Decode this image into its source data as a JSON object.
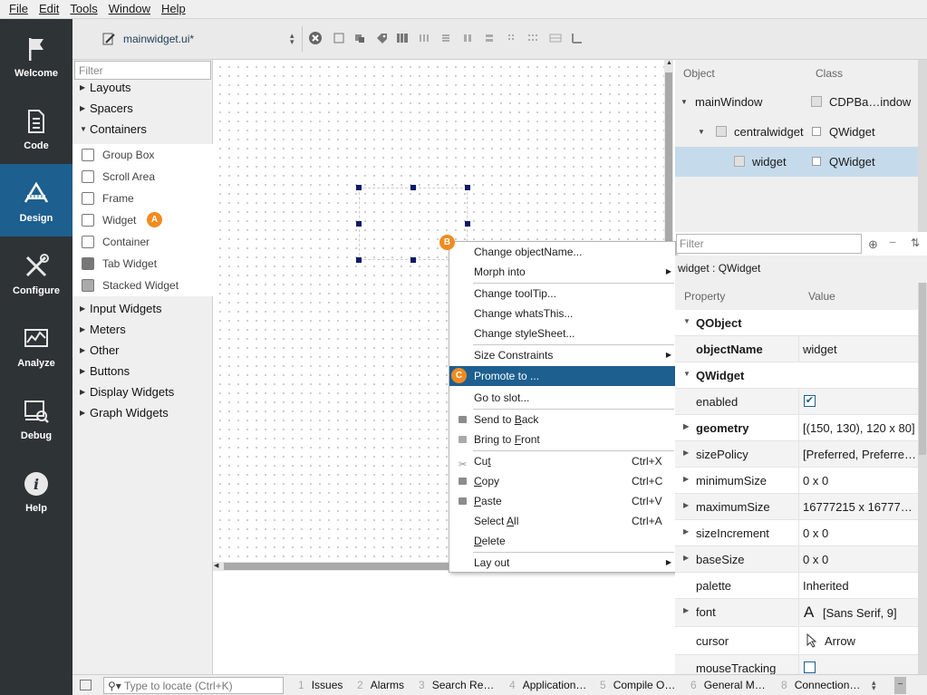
{
  "menubar": [
    "File",
    "Edit",
    "Tools",
    "Window",
    "Help"
  ],
  "modes": [
    {
      "label": "Welcome",
      "icon": "flag-icon"
    },
    {
      "label": "Code",
      "icon": "document-icon"
    },
    {
      "label": "Design",
      "icon": "design-icon"
    },
    {
      "label": "Configure",
      "icon": "tools-icon"
    },
    {
      "label": "Analyze",
      "icon": "chart-icon"
    },
    {
      "label": "Debug",
      "icon": "debug-icon"
    },
    {
      "label": "Help",
      "icon": "info-icon"
    }
  ],
  "toolbar": {
    "file_name": "mainwidget.ui*"
  },
  "widget_box": {
    "filter_placeholder": "Filter",
    "categories_top": [
      "Layouts",
      "Spacers",
      "Containers"
    ],
    "container_items": [
      "Group Box",
      "Scroll Area",
      "Frame",
      "Widget",
      "Container",
      "Tab Widget",
      "Stacked Widget"
    ],
    "categories_bottom": [
      "Input Widgets",
      "Meters",
      "Other",
      "Buttons",
      "Display Widgets",
      "Graph Widgets"
    ],
    "badge_a": "A"
  },
  "badges": {
    "b": "B",
    "c": "C"
  },
  "context_menu": {
    "change_object_name": "Change objectName...",
    "morph_into": "Morph into",
    "change_tooltip": "Change toolTip...",
    "change_whatsthis": "Change whatsThis...",
    "change_stylesheet": "Change styleSheet...",
    "size_constraints": "Size Constraints",
    "promote_to": "Promote to ...",
    "go_to_slot": "Go to slot...",
    "send_to_back_pre": "Send to ",
    "send_to_back_u": "B",
    "send_to_back_post": "ack",
    "bring_to_front_pre": "Bring to ",
    "bring_to_front_u": "F",
    "bring_to_front_post": "ront",
    "cut_pre": "Cu",
    "cut_u": "t",
    "cut_shortcut": "Ctrl+X",
    "copy_u": "C",
    "copy_post": "opy",
    "copy_shortcut": "Ctrl+C",
    "paste_u": "P",
    "paste_post": "aste",
    "paste_shortcut": "Ctrl+V",
    "select_all_pre": "Select ",
    "select_all_u": "A",
    "select_all_post": "ll",
    "select_all_shortcut": "Ctrl+A",
    "delete_u": "D",
    "delete_post": "elete",
    "lay_out": "Lay out"
  },
  "object_inspector": {
    "header_object": "Object",
    "header_class": "Class",
    "rows": [
      {
        "object": "mainWindow",
        "class": "CDPBa…indow"
      },
      {
        "object": "centralwidget",
        "class": "QWidget"
      },
      {
        "object": "widget",
        "class": "QWidget"
      }
    ]
  },
  "property_editor": {
    "filter_placeholder": "Filter",
    "class_label": "widget : QWidget",
    "header_property": "Property",
    "header_value": "Value",
    "rows": [
      {
        "name": "QObject",
        "value": ""
      },
      {
        "name": "objectName",
        "value": "widget"
      },
      {
        "name": "QWidget",
        "value": ""
      },
      {
        "name": "enabled",
        "value": "",
        "checked": true
      },
      {
        "name": "geometry",
        "value": "[(150, 130), 120 x 80]"
      },
      {
        "name": "sizePolicy",
        "value": "[Preferred, Preferre…"
      },
      {
        "name": "minimumSize",
        "value": "0 x 0"
      },
      {
        "name": "maximumSize",
        "value": "16777215 x 16777…"
      },
      {
        "name": "sizeIncrement",
        "value": "0 x 0"
      },
      {
        "name": "baseSize",
        "value": "0 x 0"
      },
      {
        "name": "palette",
        "value": "Inherited"
      },
      {
        "name": "font",
        "value": "[Sans Serif, 9]",
        "glyph": "A"
      },
      {
        "name": "cursor",
        "value": "Arrow"
      },
      {
        "name": "mouseTracking",
        "value": "",
        "checked": false
      }
    ]
  },
  "status_bar": {
    "locate_placeholder": "Type to locate (Ctrl+K)",
    "panes": [
      {
        "num": "1",
        "label": "Issues"
      },
      {
        "num": "2",
        "label": "Alarms"
      },
      {
        "num": "3",
        "label": "Search Re…"
      },
      {
        "num": "4",
        "label": "Application…"
      },
      {
        "num": "5",
        "label": "Compile O…"
      },
      {
        "num": "6",
        "label": "General M…"
      },
      {
        "num": "8",
        "label": "Connection…"
      }
    ]
  },
  "colors": {
    "mode_active": "#1d5f8f",
    "badge": "#f28b1f",
    "menu_highlight": "#1d5f8f",
    "selection": "#c5dbec"
  }
}
